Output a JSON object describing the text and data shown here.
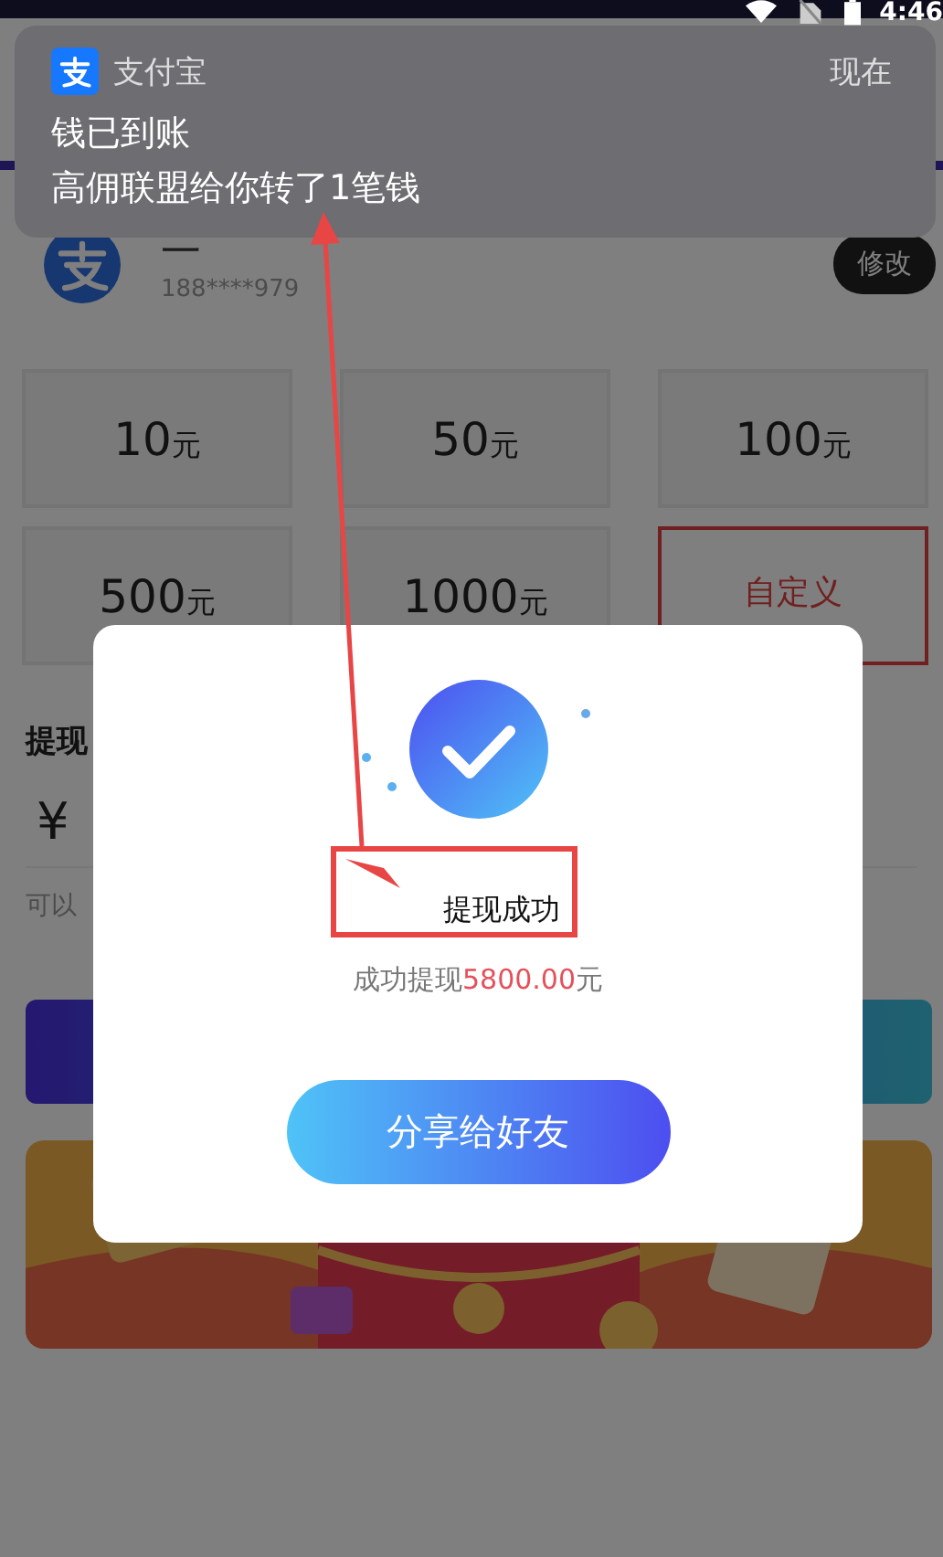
{
  "status_bar": {
    "time": "4:46"
  },
  "notification": {
    "app": "支付宝",
    "time": "现在",
    "title": "钱已到账",
    "body": "高佣联盟给你转了1笔钱"
  },
  "account": {
    "name": "一",
    "phone": "188****979",
    "edit_button": "修改"
  },
  "amounts": [
    {
      "value": "10",
      "unit": "元",
      "selected": false
    },
    {
      "value": "50",
      "unit": "元",
      "selected": false
    },
    {
      "value": "100",
      "unit": "元",
      "selected": false
    },
    {
      "value": "500",
      "unit": "元",
      "selected": false
    },
    {
      "value": "1000",
      "unit": "元",
      "selected": false
    },
    {
      "value": "自定义",
      "selected": true
    }
  ],
  "withdraw_label": "提现",
  "currency": "¥",
  "hint": "可以",
  "dialog": {
    "title": "提现成功",
    "summary": {
      "prefix": "成功提现",
      "amount": "5800.00",
      "suffix": "元"
    },
    "button": "分享给好友"
  }
}
